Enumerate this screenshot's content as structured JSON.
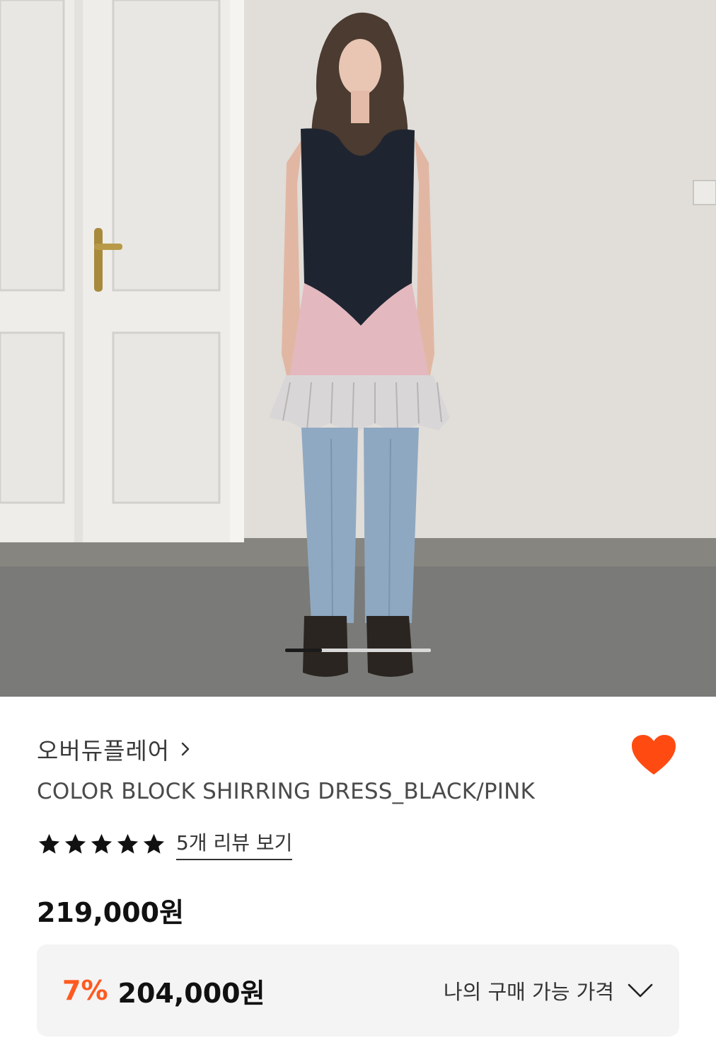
{
  "hero": {
    "image_alt": "product photo",
    "carousel": {
      "current": 1,
      "total": 4,
      "progress": 0.25
    }
  },
  "product": {
    "brand": "오버듀플레어",
    "brand_icon": "chevron-right-icon",
    "name": "COLOR BLOCK SHIRRING DRESS_BLACK/PINK",
    "rating": {
      "stars": 5,
      "max": 5,
      "review_link": "5개 리뷰 보기"
    },
    "price": "219,000원",
    "discount": {
      "rate": "7%",
      "price": "204,000원",
      "my_price_label": "나의 구매 가능 가격",
      "toggle_icon": "chevron-down-icon"
    },
    "wishlist": {
      "icon": "heart-icon",
      "active": true
    }
  },
  "colors": {
    "accent": "#ff5a1f",
    "heart": "#ff4a12",
    "text_primary": "#111111",
    "box_bg": "#f4f4f4"
  }
}
